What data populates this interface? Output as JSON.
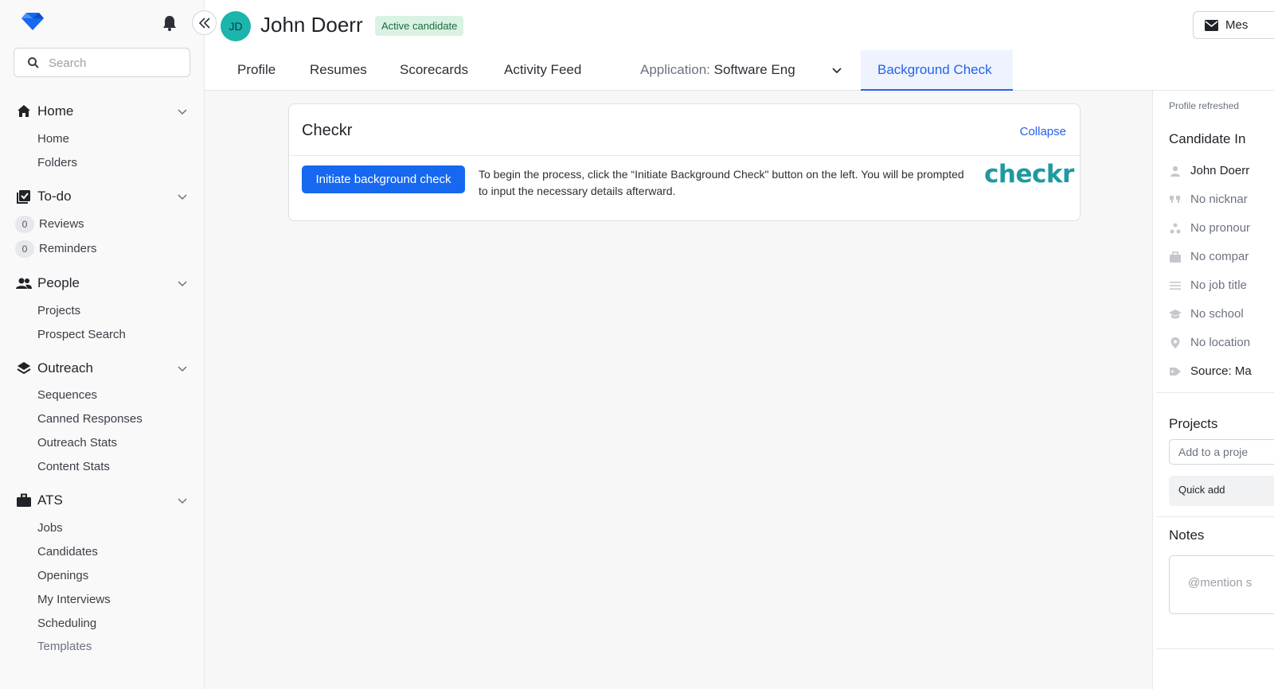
{
  "sidebar": {
    "search_placeholder": "Search",
    "sections": {
      "home": {
        "label": "Home",
        "items": [
          "Home",
          "Folders"
        ]
      },
      "todo": {
        "label": "To-do",
        "items": [
          {
            "count": "0",
            "label": "Reviews"
          },
          {
            "count": "0",
            "label": "Reminders"
          }
        ]
      },
      "people": {
        "label": "People",
        "items": [
          "Projects",
          "Prospect Search"
        ]
      },
      "outreach": {
        "label": "Outreach",
        "items": [
          "Sequences",
          "Canned Responses",
          "Outreach Stats",
          "Content Stats"
        ]
      },
      "ats": {
        "label": "ATS",
        "items": [
          "Jobs",
          "Candidates",
          "Openings",
          "My Interviews",
          "Scheduling",
          "Templates"
        ]
      }
    }
  },
  "header": {
    "avatar_initials": "JD",
    "candidate_name": "John Doerr",
    "status_badge": "Active candidate",
    "message_button": "Mes",
    "tabs": [
      "Profile",
      "Resumes",
      "Scorecards",
      "Activity Feed"
    ],
    "application_prefix": "Application:",
    "application_value": "Software Eng",
    "active_tab": "Background Check"
  },
  "checkr_card": {
    "title": "Checkr",
    "collapse_label": "Collapse",
    "initiate_button": "Initiate background check",
    "description": "To begin the process, click the “Initiate Background Check\" button on the left. You will be prompted to input the necessary details afterward.",
    "logo_text": "checkr"
  },
  "right_panel": {
    "refreshed_text": "Profile refreshed",
    "candidate_info_heading": "Candidate In",
    "info_rows": [
      {
        "icon": "person-icon",
        "text": "John Doerr"
      },
      {
        "icon": "quote-icon",
        "text": "No nicknar"
      },
      {
        "icon": "pronoun-icon",
        "text": "No pronour"
      },
      {
        "icon": "briefcase-icon",
        "text": "No compar"
      },
      {
        "icon": "lines-icon",
        "text": "No job title"
      },
      {
        "icon": "graduation-cap-icon",
        "text": "No school"
      },
      {
        "icon": "location-pin-icon",
        "text": "No location"
      },
      {
        "icon": "tag-icon",
        "text": "Source: Ma"
      }
    ],
    "projects_heading": "Projects",
    "projects_placeholder": "Add to a proje",
    "quick_add": "Quick add",
    "notes_heading": "Notes",
    "notes_placeholder": "@mention s"
  },
  "colors": {
    "accent": "#2563eb",
    "primary_button": "#1668f0",
    "avatar": "#1bb5ad",
    "badge_bg": "#d9f2e3",
    "checkr_brand": "#1e9aa0"
  }
}
